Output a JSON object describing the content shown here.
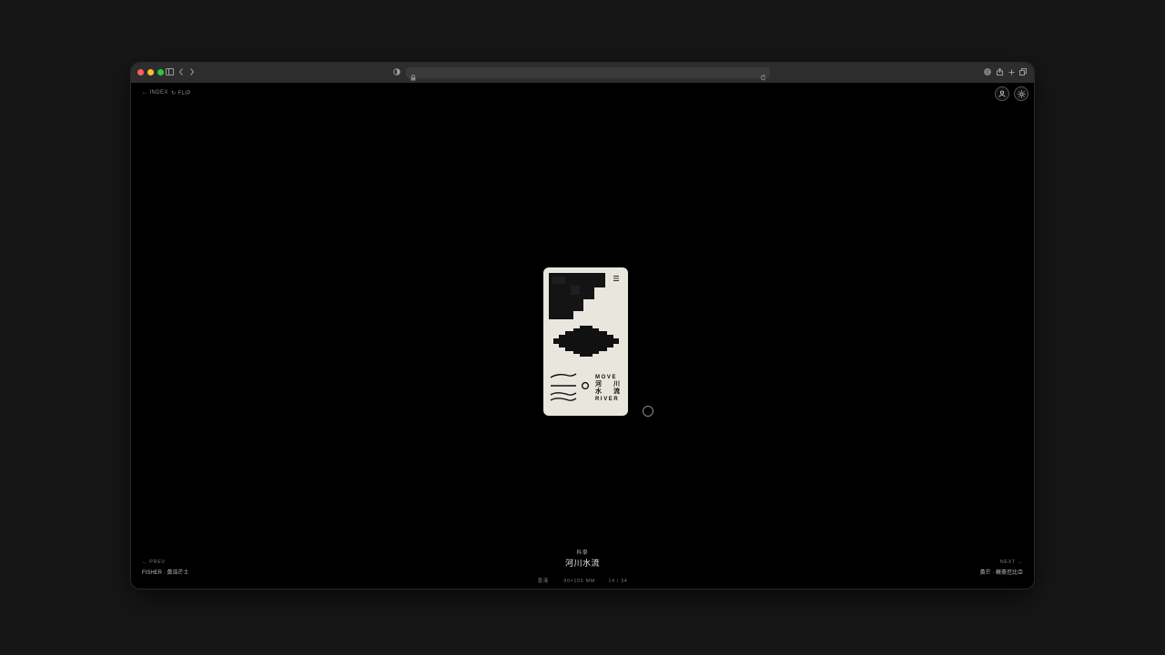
{
  "nav": {
    "index_label": "← INDEX",
    "flip_label": "↻ FLIP"
  },
  "icons": {
    "user": "user-icon",
    "theme": "sun-icon"
  },
  "artwork": {
    "alt_text": "MOVE 河 川 水 流 RIVER"
  },
  "info": {
    "category": "科學",
    "title": "河川水流",
    "origin": "香港",
    "size": "90×155 MM",
    "counter": "14 / 34"
  },
  "prev": {
    "label": "← PREV",
    "name": "FISHER · 黃浩芒士"
  },
  "next": {
    "label": "NEXT →",
    "name": "黃芒 · 蘇豪厄比亞"
  },
  "colors": {
    "close": "#ff5f57",
    "minimize": "#febc2e",
    "maximize": "#28c840",
    "card_bg": "#e9e6de",
    "ink": "#111111"
  }
}
